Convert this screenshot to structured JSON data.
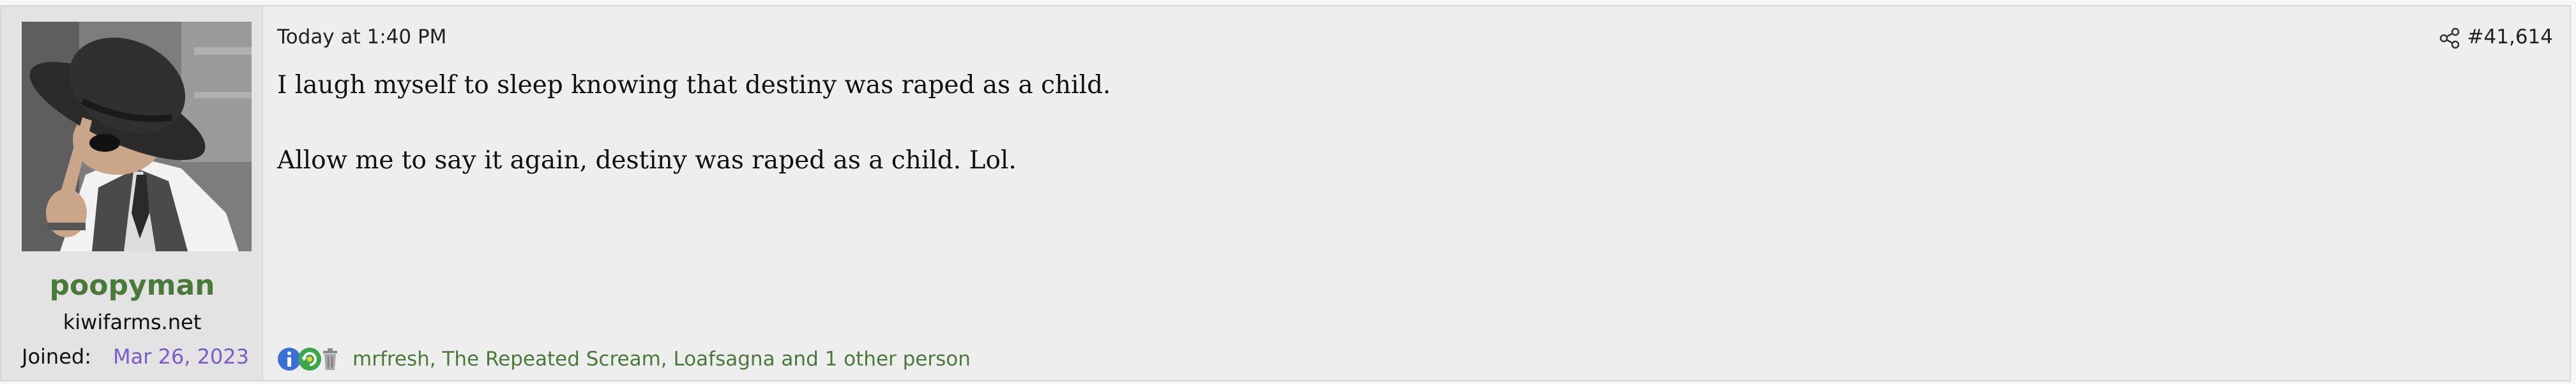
{
  "user": {
    "username": "poopyman",
    "user_title": "kiwifarms.net",
    "joined_label": "Joined:",
    "joined_date": "Mar 26, 2023"
  },
  "post": {
    "timestamp": "Today at 1:40 PM",
    "post_number": "#41,614",
    "paragraphs": [
      "I laugh myself to sleep knowing that destiny was raped as a child.",
      "Allow me to say it again, destiny was raped as a child. Lol."
    ]
  },
  "reactions": {
    "icons": [
      "informative-icon",
      "winner-icon",
      "trash-icon"
    ],
    "users_text": "mrfresh, The Repeated Scream, Loafsagna and 1 other person"
  },
  "colors": {
    "username": "#4a7a3a",
    "joined_date": "#7b5bc9",
    "reaction_link": "#4a7a3a",
    "post_background": "#eeeeee",
    "user_column_background": "#e3e3e3"
  }
}
